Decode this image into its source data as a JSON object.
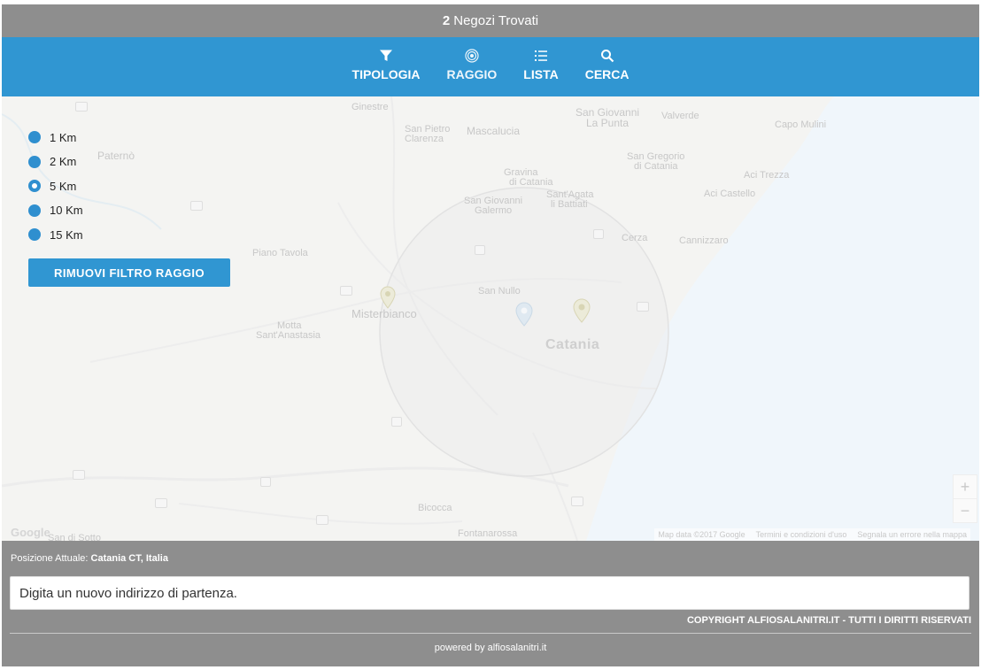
{
  "header": {
    "count": "2",
    "title_suffix": "Negozi Trovati"
  },
  "nav": {
    "items": [
      {
        "label": "TIPOLOGIA",
        "icon": "filter-icon"
      },
      {
        "label": "RAGGIO",
        "icon": "radius-icon"
      },
      {
        "label": "LISTA",
        "icon": "list-icon"
      },
      {
        "label": "CERCA",
        "icon": "search-icon"
      }
    ]
  },
  "radius": {
    "options": [
      "1 Km",
      "2 Km",
      "5 Km",
      "10 Km",
      "15 Km"
    ],
    "selected": "5 Km",
    "remove_label": "RIMUOVI FILTRO RAGGIO"
  },
  "map": {
    "labels": {
      "ginestre": "Ginestre",
      "san_pietro": "San Pietro",
      "clarenza": "Clarenza",
      "mascalucia": "Mascalucia",
      "san_giovanni_punta_1": "San Giovanni",
      "san_giovanni_punta_2": "La Punta",
      "valverde": "Valverde",
      "capo_mulini": "Capo Mulini",
      "paterno": "Paternò",
      "san_gregorio_1": "San Gregorio",
      "san_gregorio_2": "di Catania",
      "gravina_1": "Gravina",
      "gravina_2": "di Catania",
      "aci_trezza": "Aci Trezza",
      "sant_agata_1": "Sant'Agata",
      "sant_agata_2": "li Battiati",
      "aci_castello": "Aci Castello",
      "san_giovanni_galermo_1": "San Giovanni",
      "san_giovanni_galermo_2": "Galermo",
      "cerza": "Cerza",
      "cannizzaro": "Cannizzaro",
      "piano_tavola": "Piano Tavola",
      "san_nullo": "San Nullo",
      "misterbianco": "Misterbianco",
      "motta_1": "Motta",
      "motta_2": "Sant'Anastasia",
      "catania": "Catania",
      "bicocca": "Bicocca",
      "fontanarossa": "Fontanarossa",
      "san_di_sotto": "San di Sotto"
    },
    "google": "Google",
    "attribution": [
      "Map data ©2017 Google",
      "Termini e condizioni d'uso",
      "Segnala un errore nella mappa"
    ],
    "zoom_in": "+",
    "zoom_out": "−"
  },
  "footer": {
    "position_label": "Posizione Attuale:",
    "position_value": "Catania CT, Italia",
    "input_placeholder": "Digita un nuovo indirizzo di partenza.",
    "copyright": "COPYRIGHT ALFIOSALANITRI.IT - TUTTI I DIRITTI RISERVATI",
    "powered_prefix": "powered by",
    "powered_link": "alfiosalanitri.it"
  }
}
